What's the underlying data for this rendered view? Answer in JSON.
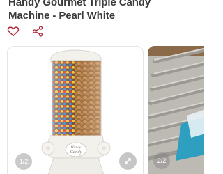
{
  "product": {
    "title_line1": "Handy Gourmet Triple Candy",
    "title_line2": "Machine - Pearl White"
  },
  "actions": {
    "favorite_icon": "heart-icon",
    "share_icon": "share-icon"
  },
  "gallery": {
    "slides": [
      {
        "counter": "1/2"
      },
      {
        "counter": "2/2"
      }
    ],
    "zoom_icon": "expand-icon",
    "logo_line1": "Handy",
    "logo_line2": "Candy"
  },
  "colors": {
    "title_text": "#3b3b3b",
    "icon_accent": "#b2293b",
    "machine_white": "#f3f1ec"
  }
}
